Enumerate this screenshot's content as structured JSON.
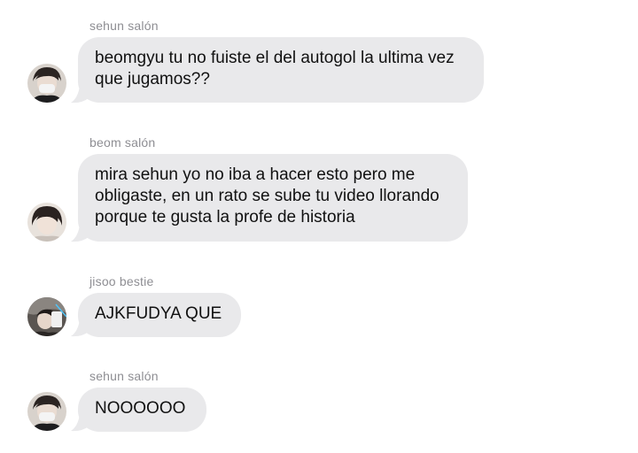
{
  "messages": [
    {
      "sender": "sehun salón",
      "avatar_icon": "sehun-avatar",
      "lines": [
        "beomgyu tu no fuiste el del autogol la ultima vez",
        "que jugamos??"
      ]
    },
    {
      "sender": "beom salón",
      "avatar_icon": "beom-avatar",
      "lines": [
        "mira sehun yo no iba a hacer esto pero me",
        "obligaste, en un rato se sube tu video llorando",
        "porque te gusta la profe de historia"
      ]
    },
    {
      "sender": "jisoo bestie",
      "avatar_icon": "jisoo-avatar",
      "lines": [
        "AJKFUDYA QUE"
      ]
    },
    {
      "sender": "sehun salón",
      "avatar_icon": "sehun-avatar",
      "lines": [
        "NOOOOOO"
      ]
    }
  ],
  "colors": {
    "bubble": "#e9e9eb",
    "sender_text": "#8e8e93",
    "message_text": "#111111"
  }
}
